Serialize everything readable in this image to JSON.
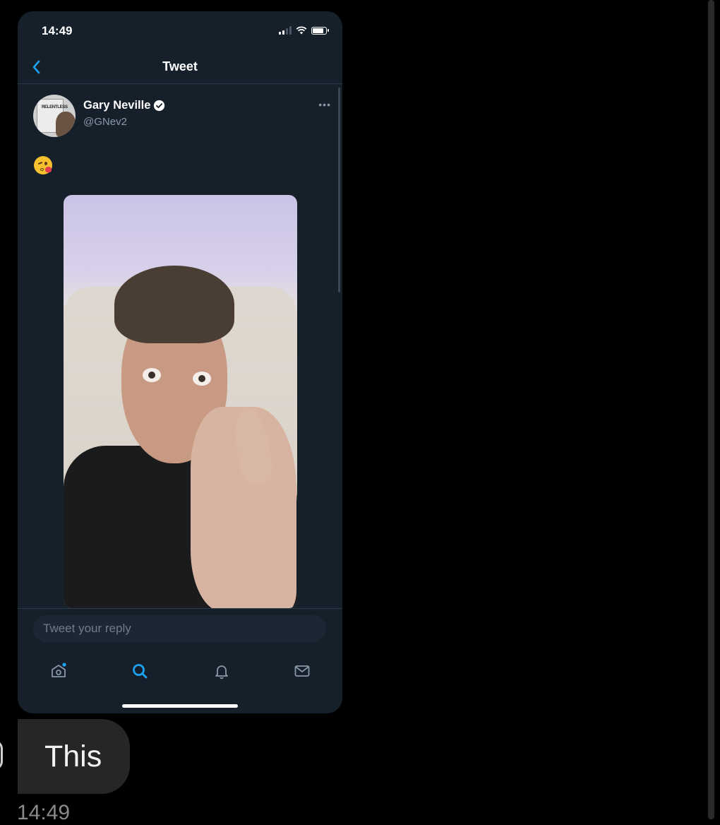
{
  "status_bar": {
    "time": "14:49"
  },
  "header": {
    "title": "Tweet"
  },
  "tweet": {
    "display_name": "Gary Neville",
    "handle": "@GNev2",
    "text": "😘",
    "avatar_book_text": "RELENTLESS"
  },
  "reply": {
    "placeholder": "Tweet your reply"
  },
  "tabs": [
    {
      "icon": "home-icon",
      "active": false
    },
    {
      "icon": "search-icon",
      "active": true
    },
    {
      "icon": "notifications-bell-icon",
      "active": false
    },
    {
      "icon": "messages-envelope-icon",
      "active": false
    }
  ],
  "message": {
    "text": "This",
    "time": "14:49"
  },
  "colors": {
    "background": "#000000",
    "app_background": "#15202b",
    "accent": "#1da1f2",
    "muted_text": "#8899a6",
    "bubble": "#262626"
  }
}
